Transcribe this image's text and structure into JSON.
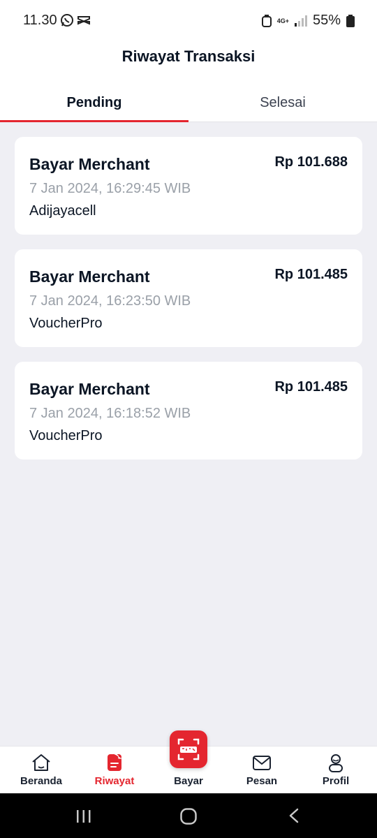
{
  "status_bar": {
    "time": "11.30",
    "battery": "55%",
    "network": "4G+"
  },
  "header": {
    "title": "Riwayat Transaksi"
  },
  "tabs": [
    {
      "label": "Pending",
      "active": true
    },
    {
      "label": "Selesai",
      "active": false
    }
  ],
  "transactions": [
    {
      "title": "Bayar Merchant",
      "amount": "Rp 101.688",
      "date": "7 Jan 2024, 16:29:45 WIB",
      "merchant": "Adijayacell"
    },
    {
      "title": "Bayar Merchant",
      "amount": "Rp 101.485",
      "date": "7 Jan 2024, 16:23:50 WIB",
      "merchant": "VoucherPro"
    },
    {
      "title": "Bayar Merchant",
      "amount": "Rp 101.485",
      "date": "7 Jan 2024, 16:18:52 WIB",
      "merchant": "VoucherPro"
    }
  ],
  "bottom_nav": [
    {
      "label": "Beranda",
      "icon": "home-icon",
      "active": false
    },
    {
      "label": "Riwayat",
      "icon": "history-icon",
      "active": true
    },
    {
      "label": "Bayar",
      "icon": "qris-icon",
      "active": false
    },
    {
      "label": "Pesan",
      "icon": "mail-icon",
      "active": false
    },
    {
      "label": "Profil",
      "icon": "profile-icon",
      "active": false
    }
  ],
  "colors": {
    "accent": "#e4262f",
    "background": "#efeff4",
    "text": "#0b1524",
    "muted": "#9aa0a8"
  }
}
